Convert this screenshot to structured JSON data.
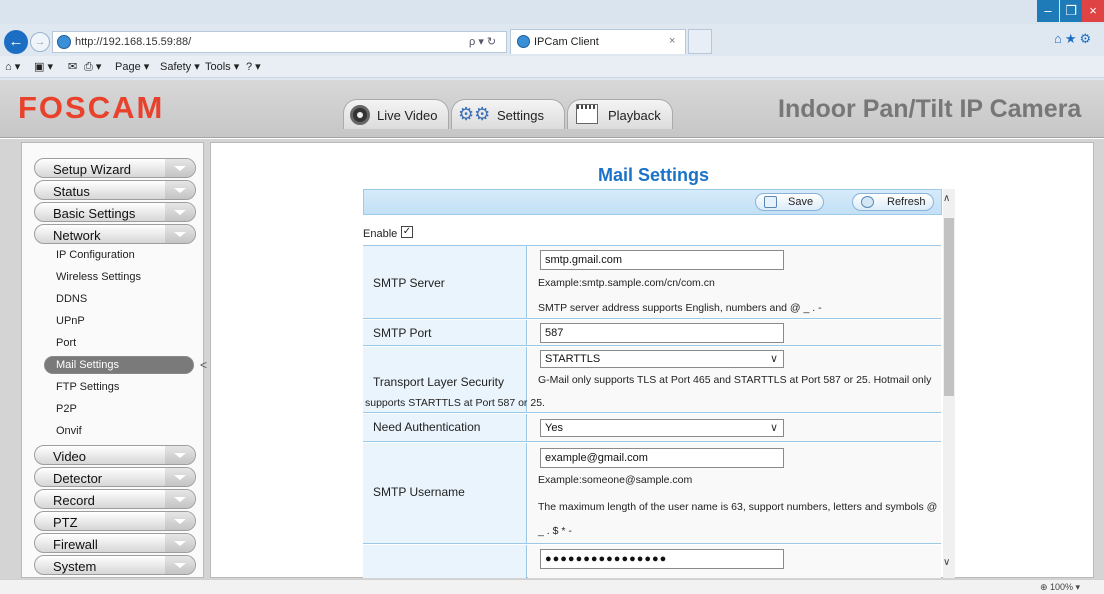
{
  "browser": {
    "url": "http://192.168.15.59:88/",
    "address_actions": "ρ ▾ ↻",
    "tab_title": "IPCam Client",
    "tab_close": "×",
    "back": "←",
    "forward": "→",
    "right_icons": "⌂★⚙",
    "window_min": "–",
    "window_max": "❐",
    "window_close": "×",
    "commands": {
      "home": "⌂ ▾",
      "feeds": "▣ ▾",
      "mail": "✉",
      "print": "⎙ ▾",
      "page": "Page ▾",
      "safety": "Safety ▾",
      "tools": "Tools ▾",
      "help": "? ▾"
    },
    "zoom": "⊕ 100%  ▾"
  },
  "header": {
    "logo": "FOSCAM",
    "camera_title": "Indoor Pan/Tilt IP Camera",
    "tabs": {
      "live_video": "Live Video",
      "settings": "Settings",
      "playback": "Playback"
    }
  },
  "sidebar": {
    "menus_top": [
      "Setup Wizard",
      "Status",
      "Basic Settings",
      "Network"
    ],
    "network_subitems": [
      "IP Configuration",
      "Wireless Settings",
      "DDNS",
      "UPnP",
      "Port",
      "Mail Settings",
      "FTP Settings",
      "P2P",
      "Onvif"
    ],
    "menus_bottom": [
      "Video",
      "Detector",
      "Record",
      "PTZ",
      "Firewall",
      "System"
    ]
  },
  "main": {
    "title": "Mail Settings",
    "save_label": "Save",
    "refresh_label": "Refresh",
    "enable_label": "Enable",
    "enable_checked": "✓",
    "rows": {
      "smtp_server": {
        "label": "SMTP Server",
        "value": "smtp.gmail.com",
        "example": "Example:smtp.sample.com/cn/com.cn",
        "note": "SMTP server address supports English, numbers and @ _ . -"
      },
      "smtp_port": {
        "label": "SMTP Port",
        "value": "587"
      },
      "tls": {
        "label": "Transport Layer Security",
        "value": "STARTTLS",
        "note_line1": "G-Mail only supports TLS at Port 465 and STARTTLS at Port 587 or 25. Hotmail only",
        "note_line2": "supports STARTTLS at Port 587 or 25."
      },
      "need_auth": {
        "label": "Need Authentication",
        "value": "Yes"
      },
      "smtp_username": {
        "label": "SMTP Username",
        "value": "example@gmail.com",
        "example": "Example:someone@sample.com",
        "note_line1": "The maximum length of the user name is 63, support numbers, letters and symbols @",
        "note_line2": "_ . $ * -"
      },
      "smtp_password": {
        "value": "●●●●●●●●●●●●●●●●"
      }
    }
  }
}
